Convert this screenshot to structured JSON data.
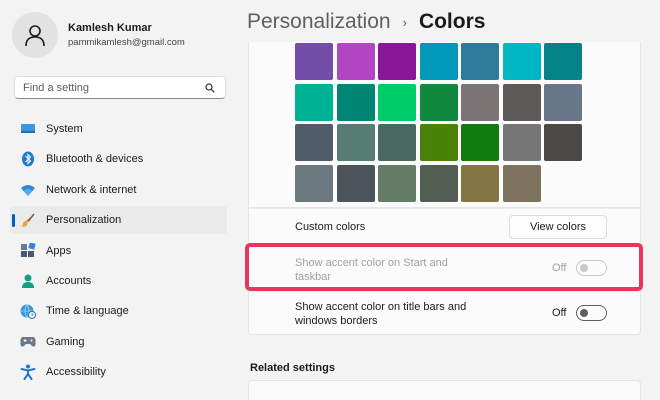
{
  "profile": {
    "name": "Kamlesh Kumar",
    "email": "pammikamlesh@gmail.com"
  },
  "search": {
    "placeholder": "Find a setting",
    "icon": "search-icon"
  },
  "sidebar": {
    "items": [
      {
        "label": "System",
        "icon": "monitor-icon"
      },
      {
        "label": "Bluetooth & devices",
        "icon": "bluetooth-icon"
      },
      {
        "label": "Network & internet",
        "icon": "wifi-icon"
      },
      {
        "label": "Personalization",
        "icon": "brush-icon",
        "active": true
      },
      {
        "label": "Apps",
        "icon": "apps-icon"
      },
      {
        "label": "Accounts",
        "icon": "person-icon"
      },
      {
        "label": "Time & language",
        "icon": "globe-clock-icon"
      },
      {
        "label": "Gaming",
        "icon": "gamepad-icon"
      },
      {
        "label": "Accessibility",
        "icon": "accessibility-icon"
      }
    ]
  },
  "breadcrumb": {
    "parent": "Personalization",
    "separator": "›",
    "current": "Colors"
  },
  "palette": {
    "rows": [
      [
        "#744da9",
        "#b146c2",
        "#881798",
        "#0099bc",
        "#2d7d9a",
        "#00b7c3",
        "#038387"
      ],
      [
        "#00b294",
        "#018574",
        "#00cc6a",
        "#10893e",
        "#7a7574",
        "#5d5a58",
        "#68768a"
      ],
      [
        "#515c6b",
        "#567c73",
        "#486860",
        "#498205",
        "#107c10",
        "#767676",
        "#4c4a48"
      ],
      [
        "#69797e",
        "#4a5459",
        "#647c64",
        "#525e54",
        "#847545",
        "#7e735f"
      ]
    ]
  },
  "custom_colors": {
    "label": "Custom colors",
    "button": "View colors"
  },
  "accent_start": {
    "label_line1": "Show accent color on Start and",
    "label_line2": "taskbar",
    "state": "Off"
  },
  "accent_title": {
    "label_line1": "Show accent color on title bars and",
    "label_line2": "windows borders",
    "state": "Off"
  },
  "colors": {
    "accent": "#005fb8",
    "highlight": "#e8365d"
  },
  "related": {
    "heading": "Related settings"
  }
}
